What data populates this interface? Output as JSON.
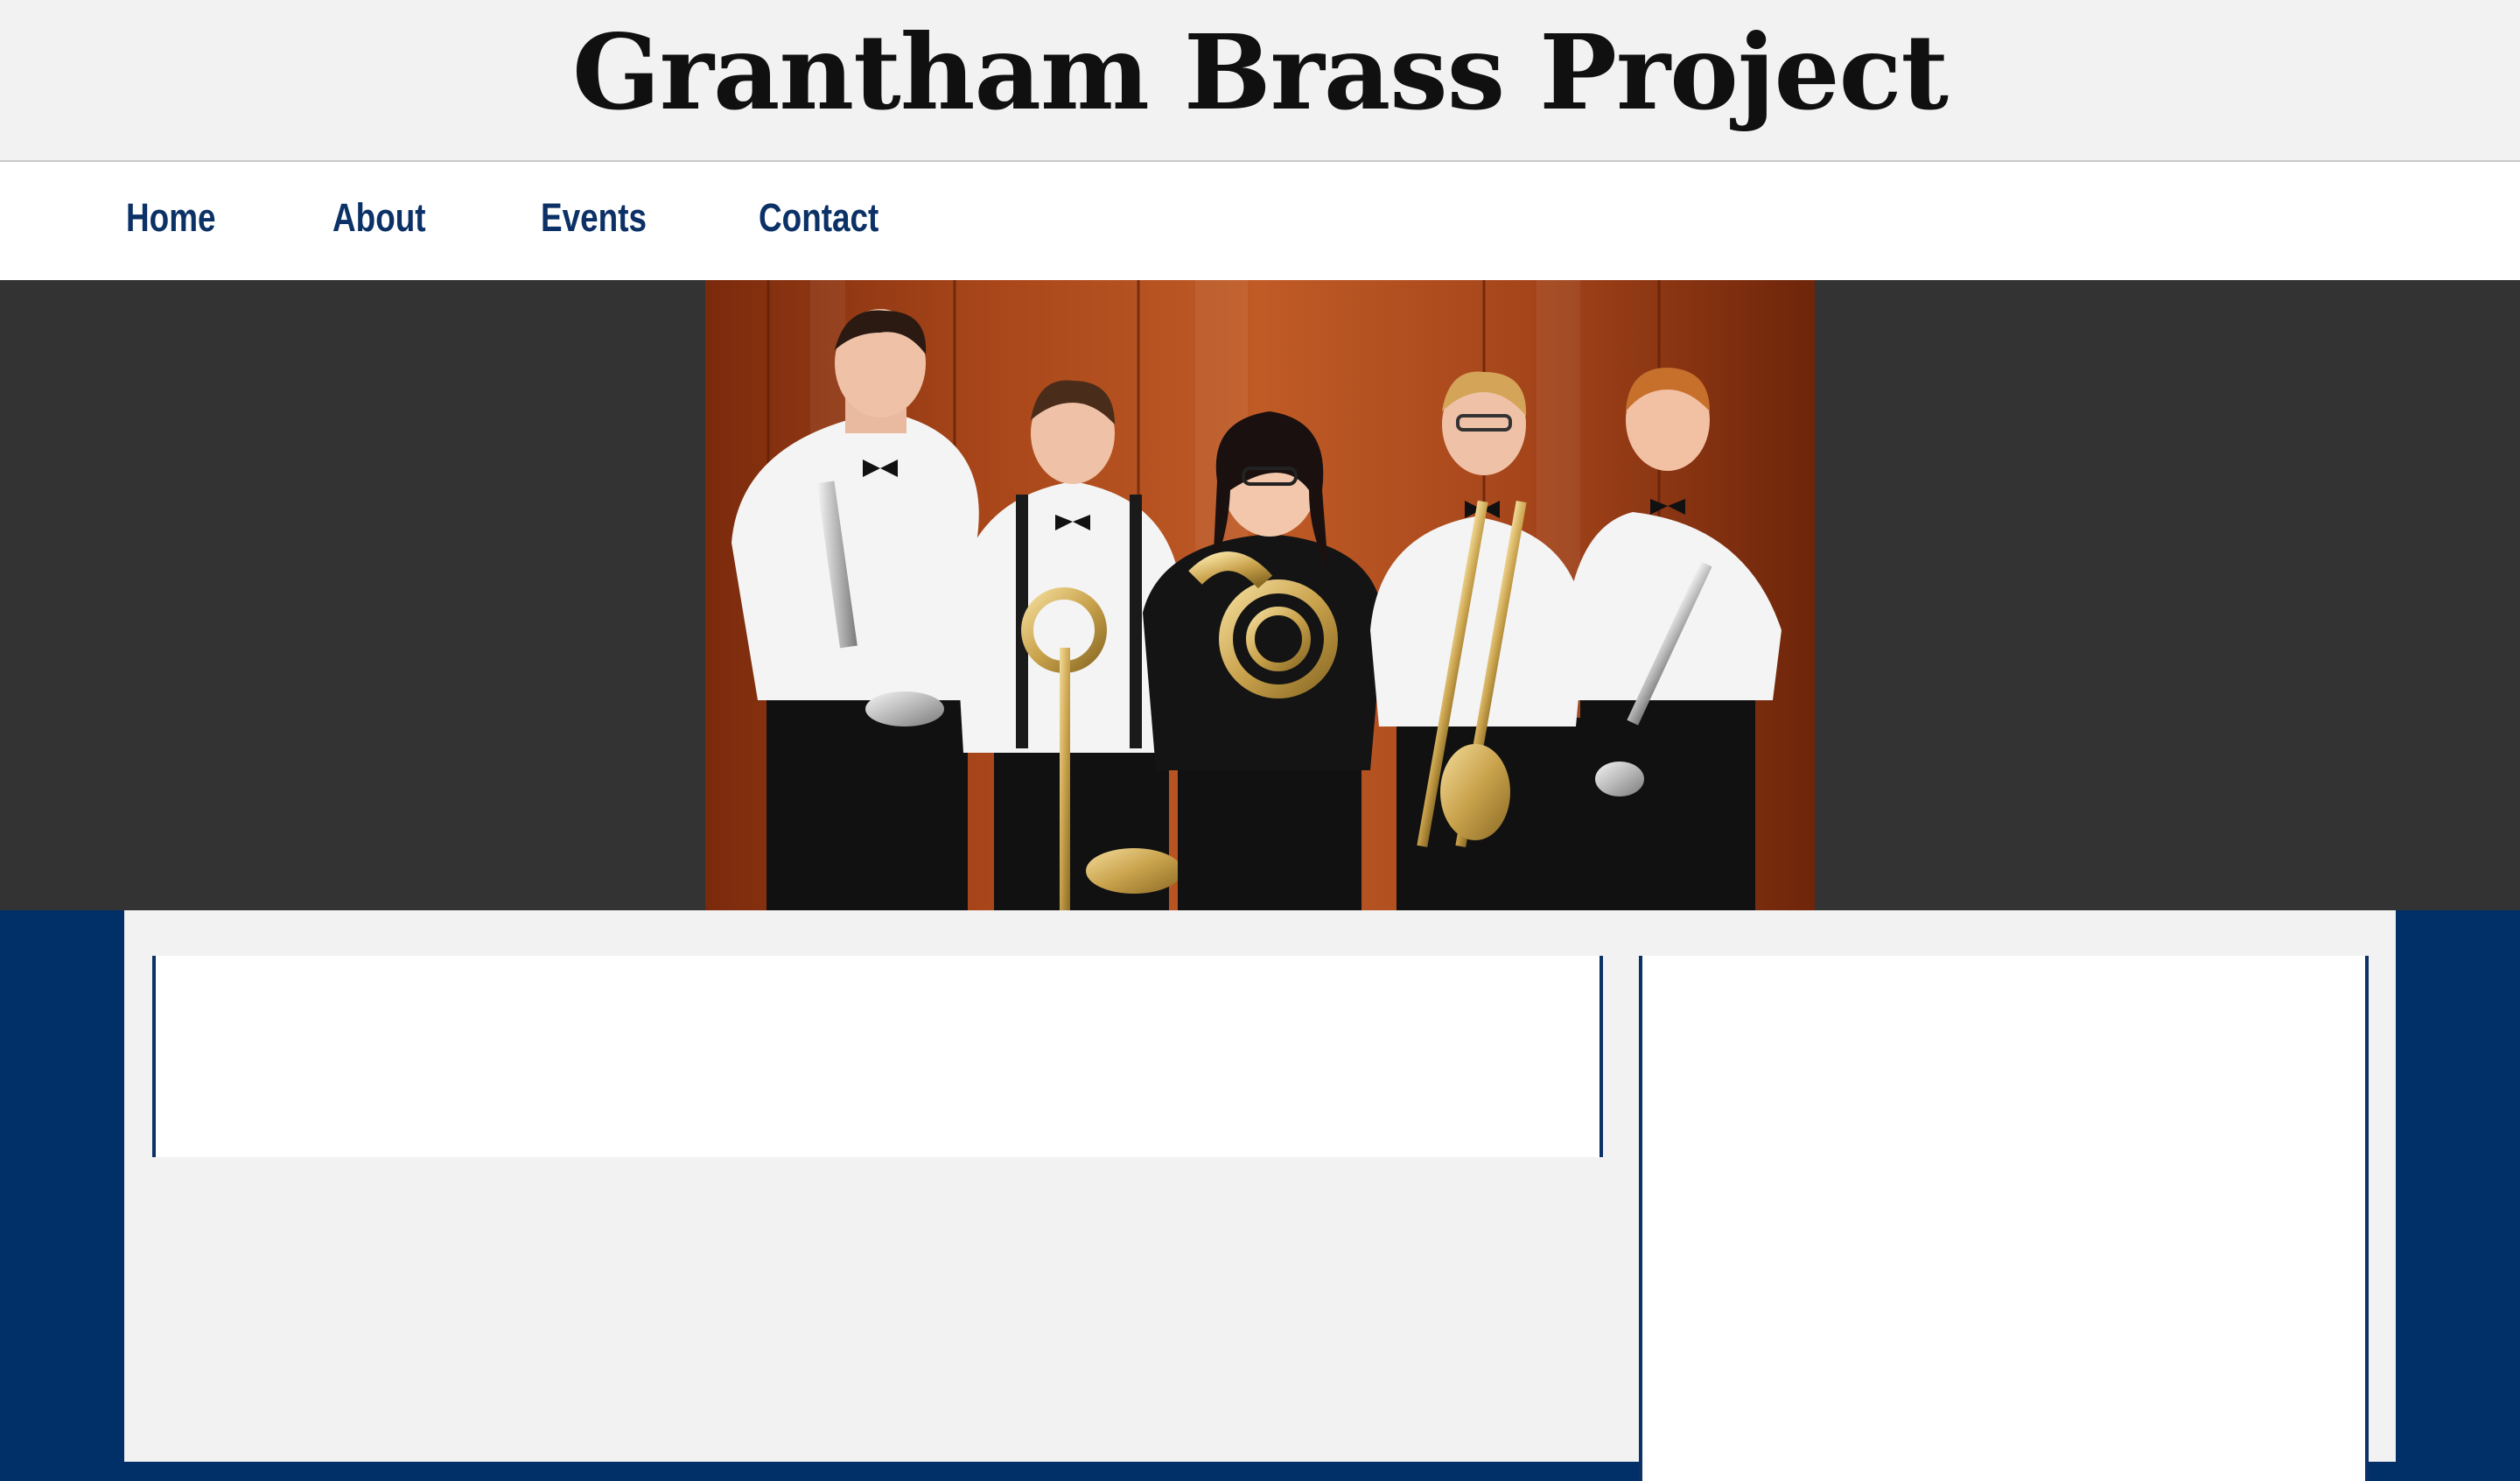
{
  "site": {
    "title": "Grantham Brass Project"
  },
  "nav": {
    "items": [
      {
        "label": "Home"
      },
      {
        "label": "About"
      },
      {
        "label": "Events"
      },
      {
        "label": "Contact"
      }
    ]
  },
  "colors": {
    "brand_navy": "#003067",
    "nav_text": "#0b3166",
    "header_bg": "#f2f2f2",
    "hero_bg": "#333333",
    "stage_wood": "#9a3a12"
  },
  "hero": {
    "image_subject": "brass-quintet-group-photo"
  }
}
